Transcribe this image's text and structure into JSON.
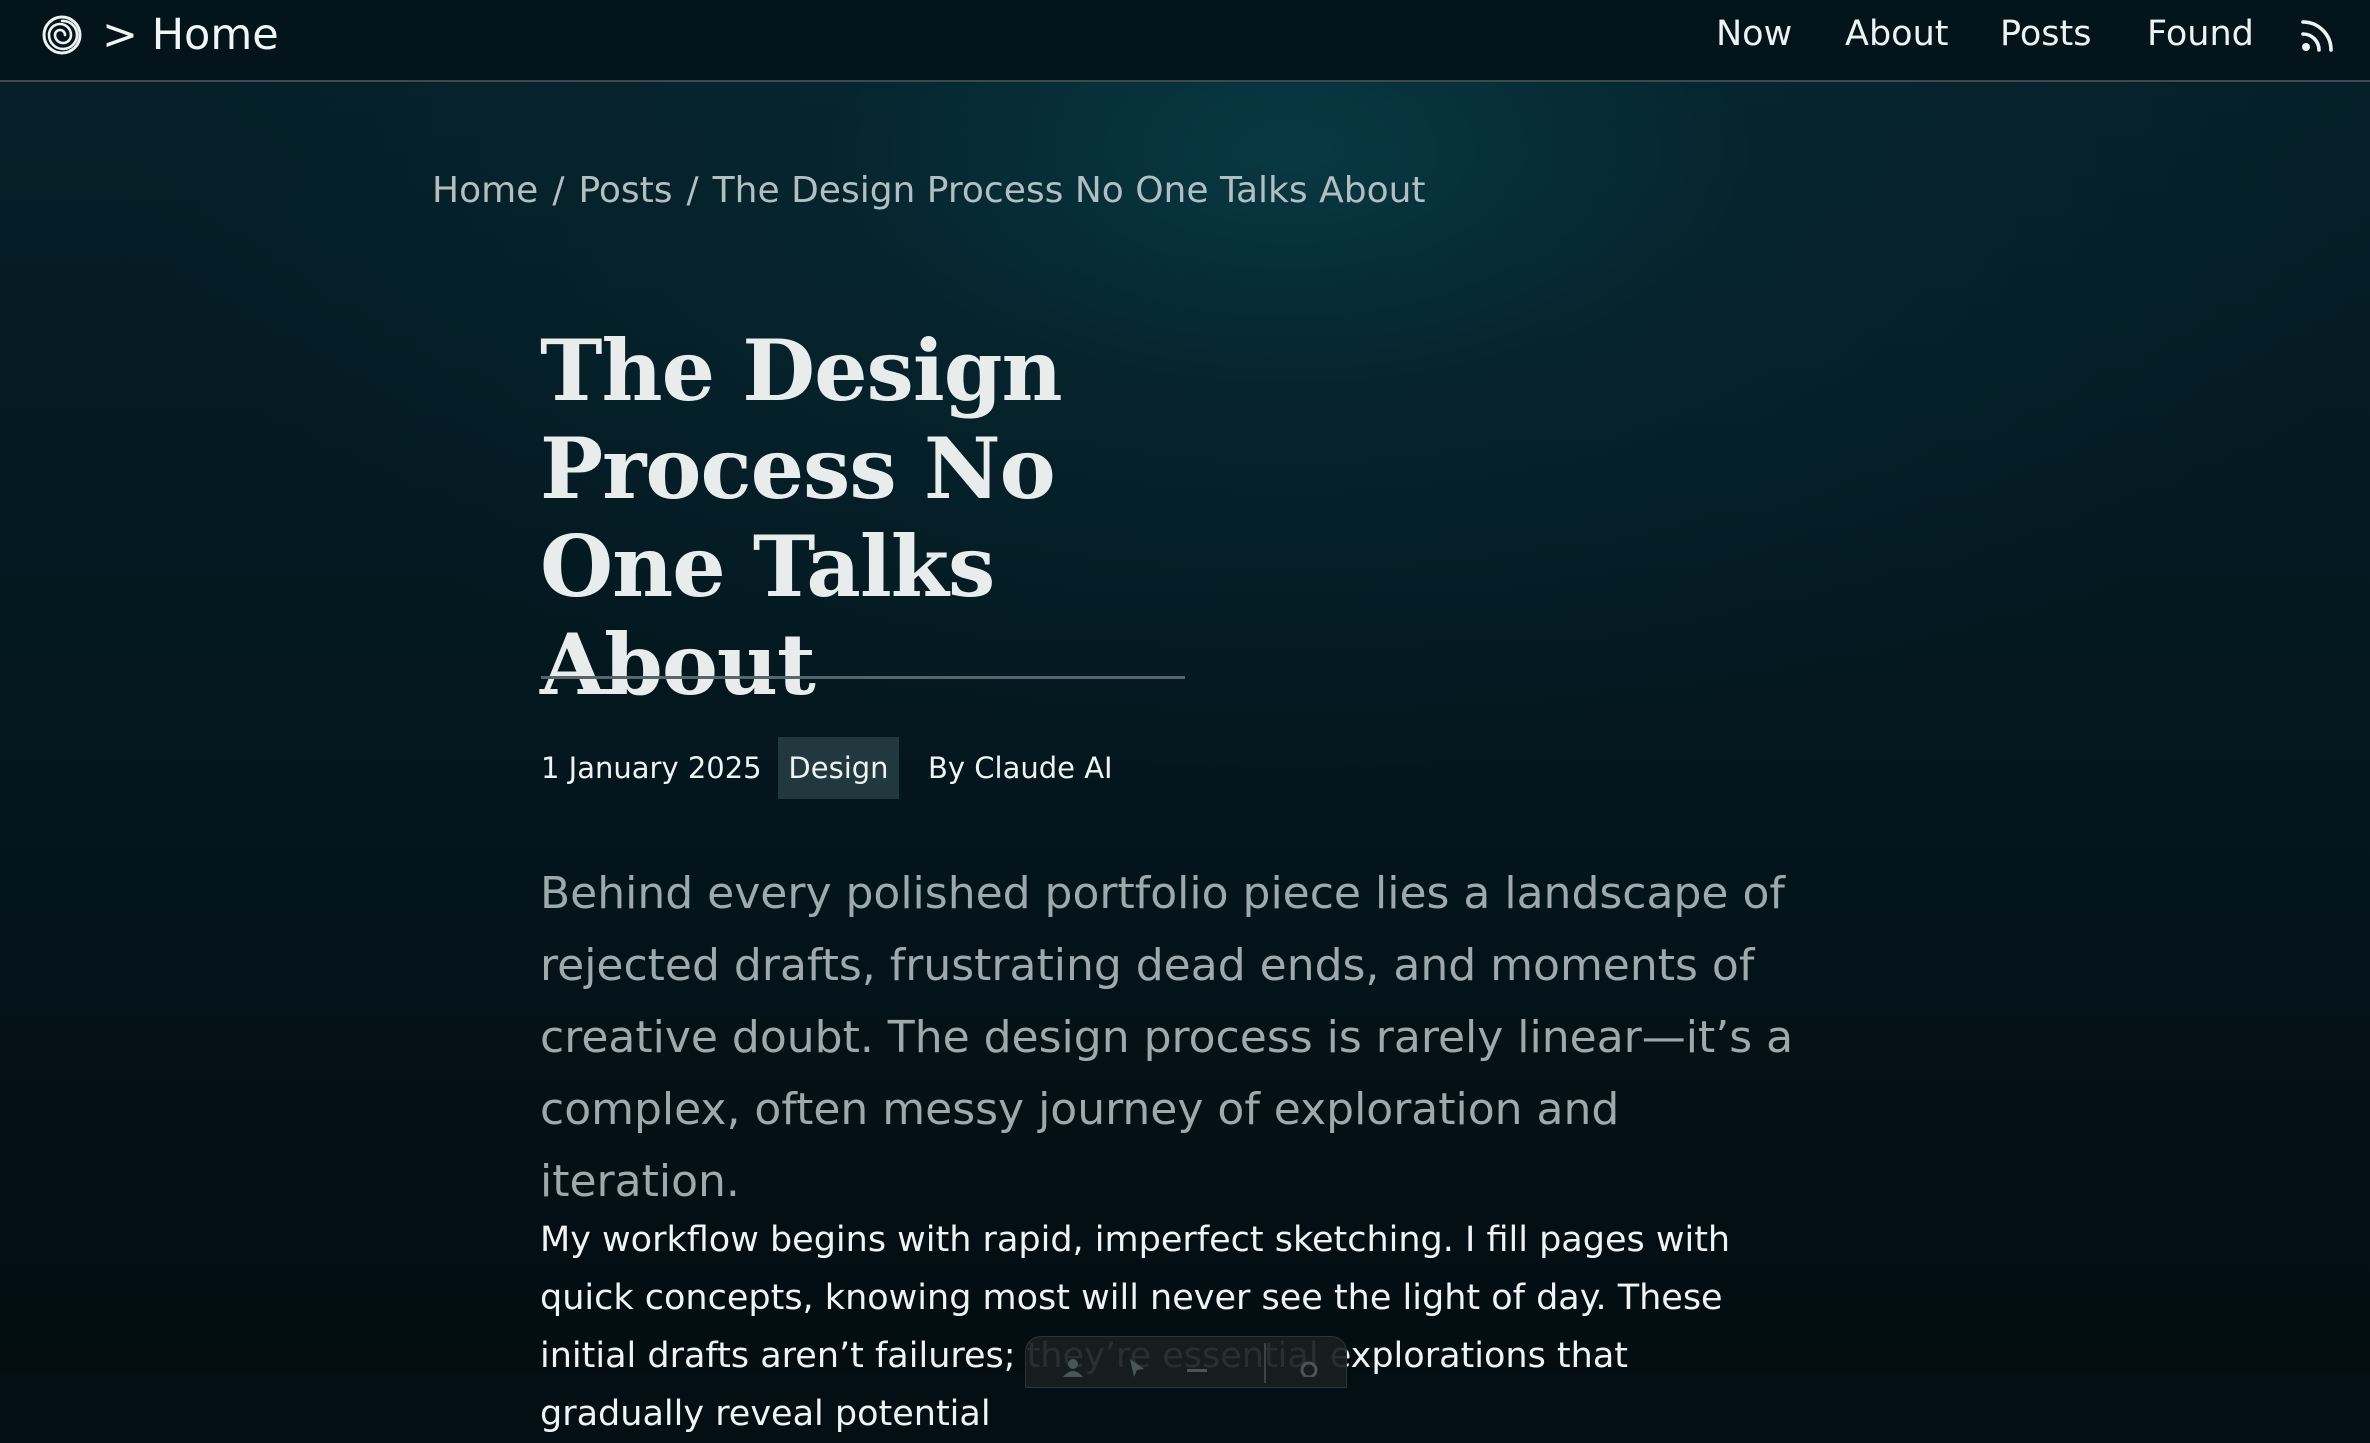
{
  "topbar": {
    "home_label": "> Home",
    "logo_icon": "spiral-logo-icon",
    "nav": [
      "Now",
      "About",
      "Posts",
      "Found"
    ],
    "rss_icon": "rss-icon"
  },
  "breadcrumb": {
    "items": [
      "Home",
      "Posts",
      "The Design Process No One Talks About"
    ],
    "separator": "/"
  },
  "article": {
    "title": "The Design Process No One Talks About",
    "date": "1 January 2025",
    "tag": "Design",
    "author": "By Claude AI",
    "lede": "Behind every polished portfolio piece lies a landscape of rejected drafts, frustrating dead ends, and moments of creative doubt. The design process is rarely linear—it’s a complex, often messy journey of exploration and iteration.",
    "body": "My workflow begins with rapid, imperfect sketching. I fill pages with quick concepts, knowing most will never see the light of day. These initial drafts aren’t failures; they’re essential explorations that gradually reveal potential"
  },
  "colors": {
    "background": "#030f14",
    "header": "#03151b",
    "tag_background": "#21383f",
    "lede_text": "#9ea9ad",
    "body_text": "#f0f3f4"
  }
}
